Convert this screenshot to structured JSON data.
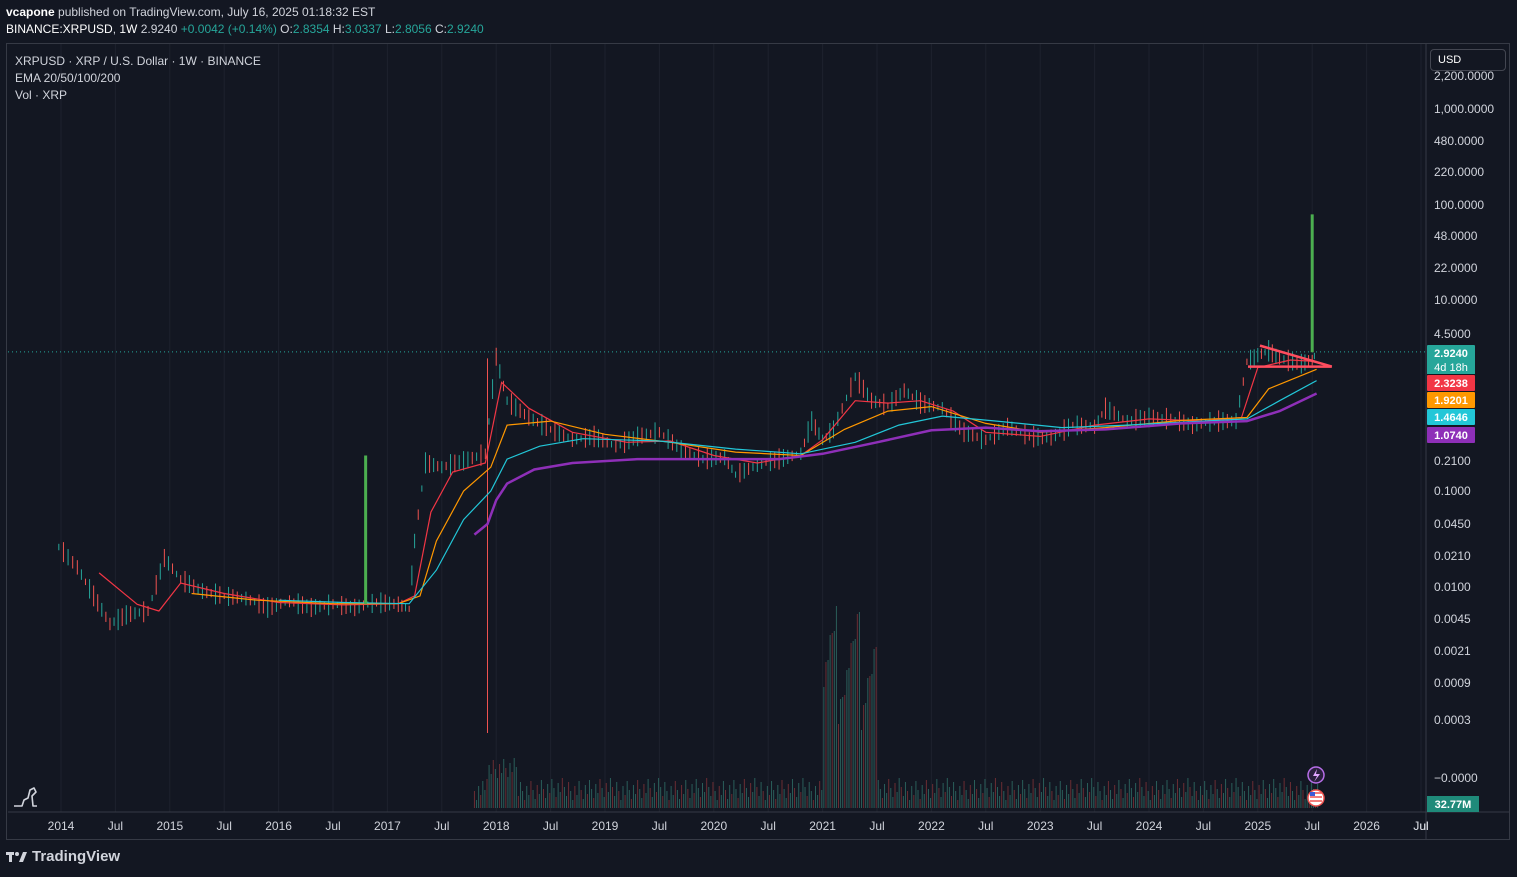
{
  "header": {
    "publisher": "vcapone",
    "published_text": "published on TradingView.com, July 16, 2025 01:18:32 EST",
    "symbol": "BINANCE:XRPUSD",
    "interval": "1W",
    "last": "2.9240",
    "change": "+0.0042 (+0.14%)",
    "open_label": "O:",
    "open": "2.8354",
    "high_label": "H:",
    "high": "3.0337",
    "low_label": "L:",
    "low": "2.8056",
    "close_label": "C:",
    "close": "2.9240"
  },
  "legend": {
    "title": "XRPUSD · XRP / U.S. Dollar · 1W · BINANCE",
    "ema": "EMA 20/50/100/200",
    "vol": "Vol · XRP"
  },
  "currency": "USD",
  "price_tag_countdown": "4d 18h",
  "footer": {
    "brand": "TradingView"
  },
  "colors": {
    "background": "#131722",
    "up": "#26a69a",
    "down": "#ef5350",
    "ema20": "#f23645",
    "ema50": "#ff9800",
    "ema100": "#22c7d8",
    "ema200": "#8e2fb8",
    "projection": "#4caf50",
    "pattern": "#ff4d5e"
  },
  "chart_data": {
    "type": "candlestick",
    "y_scale": "log",
    "x_ticks": [
      "2014",
      "Jul",
      "2015",
      "Jul",
      "2016",
      "Jul",
      "2017",
      "Jul",
      "2018",
      "Jul",
      "2019",
      "Jul",
      "2020",
      "Jul",
      "2021",
      "Jul",
      "2022",
      "Jul",
      "2023",
      "Jul",
      "2024",
      "Jul",
      "2025",
      "Jul",
      "2026",
      "Jul"
    ],
    "y_ticks": [
      "1,000.0000",
      "480.0000",
      "220.0000",
      "100.0000",
      "48.0000",
      "22.0000",
      "10.0000",
      "4.5000",
      "0.2100",
      "0.1000",
      "0.0450",
      "0.0210",
      "0.0100",
      "0.0045",
      "0.0021",
      "0.0009",
      "0.0003",
      "−0.0000"
    ],
    "y_top_partial": "2,200.0000",
    "price_labels": [
      {
        "value": "2.9240",
        "color": "#26a69a"
      },
      {
        "value": "2.3238",
        "color": "#f23645"
      },
      {
        "value": "1.9201",
        "color": "#ff9800"
      },
      {
        "value": "1.4646",
        "color": "#22c7d8"
      },
      {
        "value": "1.0740",
        "color": "#8e2fb8"
      }
    ],
    "volume_label": "32.77M",
    "series": [
      {
        "name": "EMA 20",
        "values": [
          2.32
        ]
      },
      {
        "name": "EMA 50",
        "values": [
          1.92
        ]
      },
      {
        "name": "EMA 100",
        "values": [
          1.46
        ]
      },
      {
        "name": "EMA 200",
        "values": [
          1.07
        ]
      }
    ],
    "annotations": [
      {
        "type": "vertical-projection",
        "at": "late 2016",
        "from": 0.0065,
        "to": 0.24
      },
      {
        "type": "vertical-projection",
        "at": "Jul 2025",
        "from": 2.9,
        "to": 80
      },
      {
        "type": "descending-triangle",
        "from": "Dec 2024",
        "to": "Aug 2025",
        "top": 3.4,
        "base": 2.0
      }
    ]
  }
}
